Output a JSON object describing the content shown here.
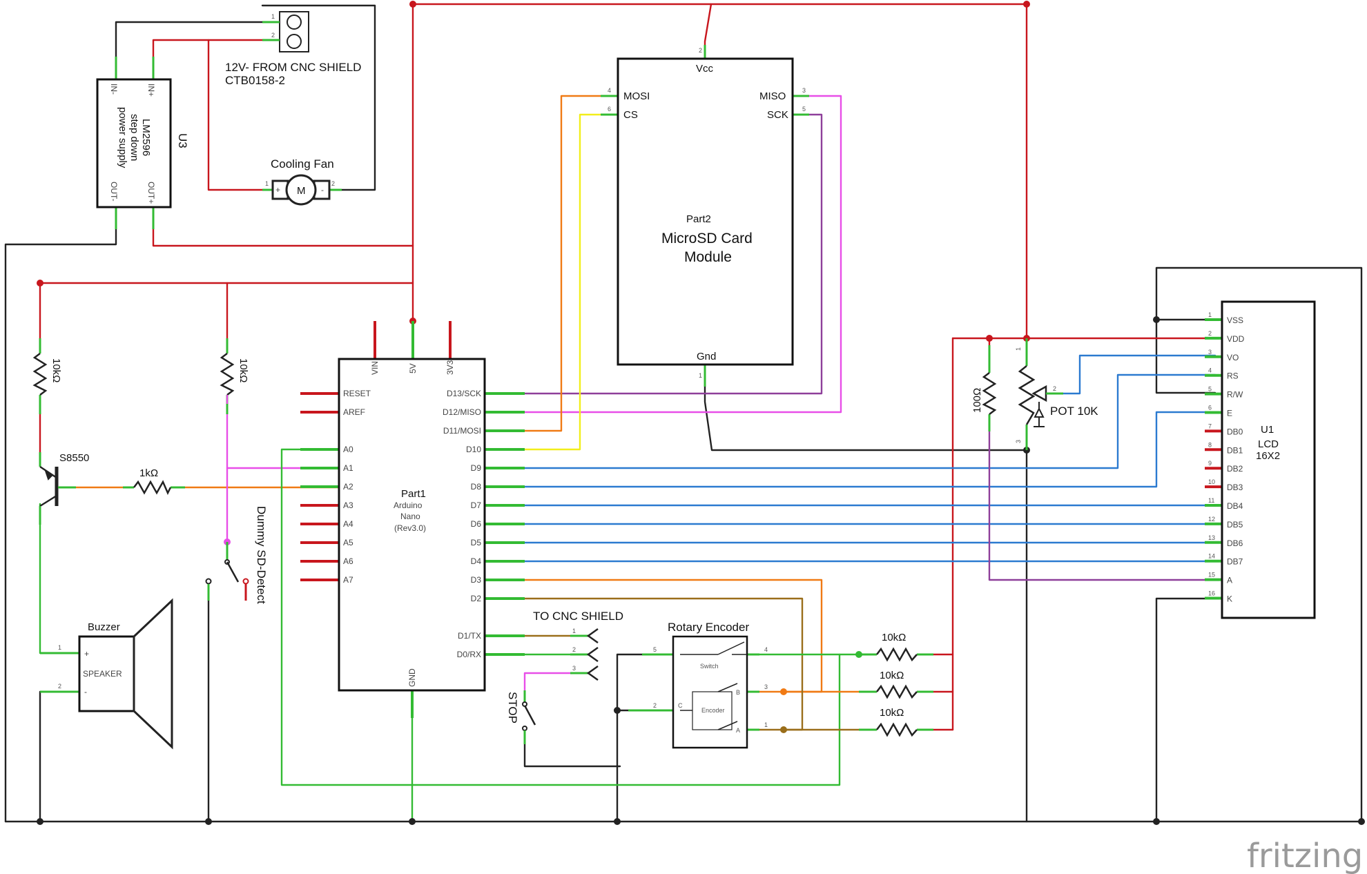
{
  "colors": {
    "black": "#222222",
    "red": "#c8161d",
    "green": "#33bb33",
    "orange": "#f07a14",
    "yellow": "#f2ee1a",
    "magenta": "#e84ee8",
    "purple": "#8e3f9a",
    "blue": "#2b7ad0",
    "brown": "#9a6e1a"
  },
  "connector": {
    "label_line1": "12V- FROM CNC SHIELD",
    "label_line2": "CTB0158-2",
    "pin1": "1",
    "pin2": "2"
  },
  "power_supply": {
    "ref": "U3",
    "name_line1": "LM2596",
    "name_line2": "step down",
    "name_line3": "power supply",
    "pins": {
      "in_minus": "IN-",
      "in_plus": "IN+",
      "out_minus": "OUT-",
      "out_plus": "OUT+"
    }
  },
  "fan": {
    "label": "Cooling Fan",
    "motor_symbol": "M",
    "plus": "+",
    "minus": "-",
    "pin1": "1",
    "pin2": "2"
  },
  "sd_module": {
    "ref": "Part2",
    "title_line1": "MicroSD Card",
    "title_line2": "Module",
    "pins": {
      "vcc": "Vcc",
      "gnd": "Gnd",
      "mosi": "MOSI",
      "cs": "CS",
      "miso": "MISO",
      "sck": "SCK"
    },
    "pin_numbers": {
      "vcc": "2",
      "gnd": "1",
      "mosi": "4",
      "cs": "6",
      "miso": "3",
      "sck": "5"
    }
  },
  "arduino": {
    "ref": "Part1",
    "name_line1": "Arduino",
    "name_line2": "Nano",
    "name_line3": "(Rev3.0)",
    "top_pins": [
      "VIN",
      "5V",
      "3V3"
    ],
    "bottom_pin": "GND",
    "left_pins": [
      "RESET",
      "AREF",
      "A0",
      "A1",
      "A2",
      "A3",
      "A4",
      "A5",
      "A6",
      "A7"
    ],
    "right_pins": [
      "D13/SCK",
      "D12/MISO",
      "D11/MOSI",
      "D10",
      "D9",
      "D8",
      "D7",
      "D6",
      "D5",
      "D4",
      "D3",
      "D2",
      "D1/TX",
      "D0/RX"
    ]
  },
  "resistors": {
    "r_left": "10kΩ",
    "r_mid": "10kΩ",
    "r_base": "1kΩ",
    "r_lcd": "100Ω",
    "r_enc1": "10kΩ",
    "r_enc2": "10kΩ",
    "r_enc3": "10kΩ"
  },
  "transistor": {
    "label": "S8550"
  },
  "buzzer": {
    "label": "Buzzer",
    "inner": "SPEAKER",
    "plus": "+",
    "minus": "-",
    "pin1": "1",
    "pin2": "2"
  },
  "sd_detect": {
    "label": "Dummy SD-Detect"
  },
  "cnc_header": {
    "label": "TO CNC SHIELD",
    "pins": [
      "1",
      "2",
      "3"
    ]
  },
  "stop_switch": {
    "label": "STOP"
  },
  "encoder": {
    "label": "Rotary Encoder",
    "switch": "Switch",
    "encoder": "Encoder",
    "pin_a": "A",
    "pin_b": "B",
    "pin_c": "C",
    "pins": [
      "5",
      "4",
      "3",
      "2",
      "1"
    ]
  },
  "pot": {
    "label": "POT 10K",
    "pin1": "1",
    "pin2": "2",
    "pin3": "3"
  },
  "lcd": {
    "ref": "U1",
    "name_line1": "LCD",
    "name_line2": "16X2",
    "pins": [
      "VSS",
      "VDD",
      "VO",
      "RS",
      "R/W",
      "E",
      "DB0",
      "DB1",
      "DB2",
      "DB3",
      "DB4",
      "DB5",
      "DB6",
      "DB7",
      "A",
      "K"
    ]
  },
  "logo": "fritzing"
}
